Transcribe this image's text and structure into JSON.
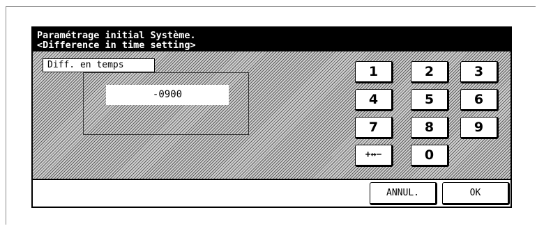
{
  "title": {
    "line1": "Paramétrage initial Système.",
    "line2": "<Difference in time setting>"
  },
  "field": {
    "label": "Diff. en temps",
    "value": "-0900"
  },
  "keypad": {
    "k1": "1",
    "k2": "2",
    "k3": "3",
    "k4": "4",
    "k5": "5",
    "k6": "6",
    "k7": "7",
    "k8": "8",
    "k9": "9",
    "sign": "+↔−",
    "k0": "0"
  },
  "buttons": {
    "cancel": "ANNUL.",
    "ok": "OK"
  }
}
